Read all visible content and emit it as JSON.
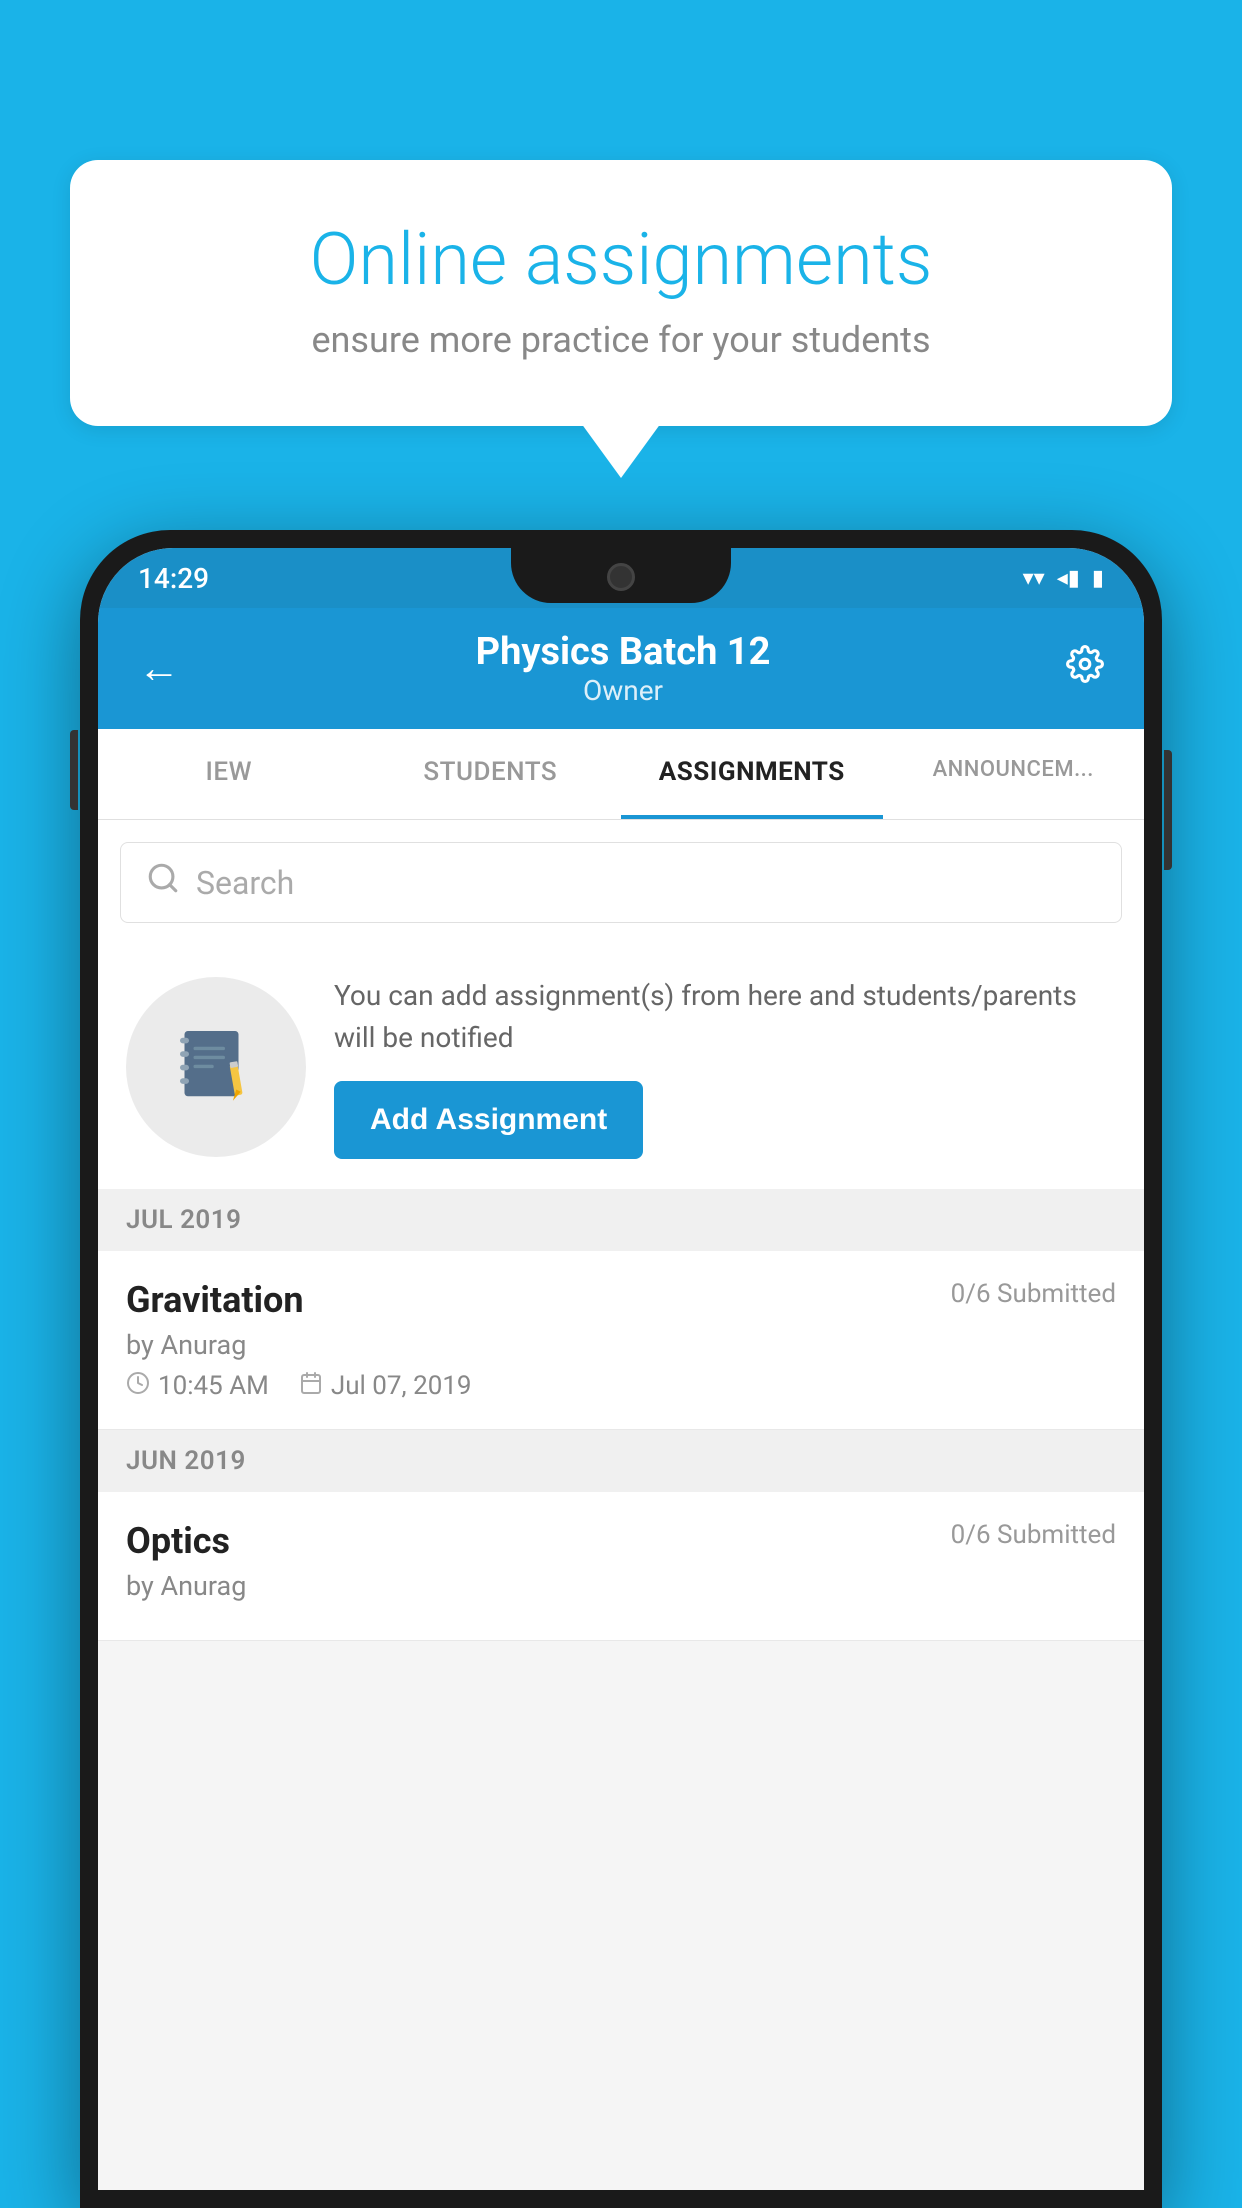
{
  "background_color": "#1ab3e8",
  "speech_bubble": {
    "title": "Online assignments",
    "subtitle": "ensure more practice for your students"
  },
  "status_bar": {
    "time": "14:29",
    "wifi": "▼",
    "signal": "◂",
    "battery": "▮"
  },
  "header": {
    "title": "Physics Batch 12",
    "subtitle": "Owner",
    "back_label": "←",
    "settings_label": "⚙"
  },
  "tabs": [
    {
      "label": "IEW",
      "active": false
    },
    {
      "label": "STUDENTS",
      "active": false
    },
    {
      "label": "ASSIGNMENTS",
      "active": true
    },
    {
      "label": "ANNOUNCEM...",
      "active": false
    }
  ],
  "search": {
    "placeholder": "Search"
  },
  "promo": {
    "description": "You can add assignment(s) from here and students/parents will be notified",
    "add_button_label": "Add Assignment"
  },
  "sections": [
    {
      "label": "JUL 2019",
      "assignments": [
        {
          "name": "Gravitation",
          "submitted": "0/6 Submitted",
          "by": "by Anurag",
          "time": "10:45 AM",
          "date": "Jul 07, 2019"
        }
      ]
    },
    {
      "label": "JUN 2019",
      "assignments": [
        {
          "name": "Optics",
          "submitted": "0/6 Submitted",
          "by": "by Anurag",
          "time": "",
          "date": ""
        }
      ]
    }
  ]
}
